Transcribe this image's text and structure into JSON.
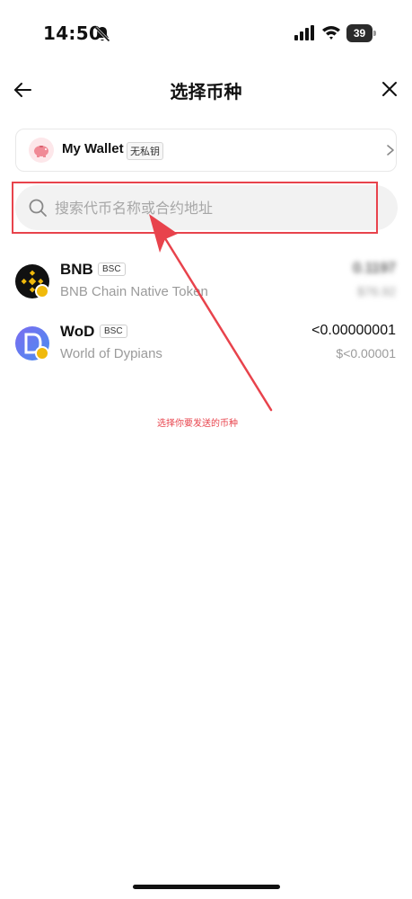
{
  "status_bar": {
    "time": "14:50",
    "battery": "39"
  },
  "header": {
    "title": "选择币种"
  },
  "wallet": {
    "name": "My Wallet",
    "tag": "无私钥"
  },
  "search": {
    "placeholder": "搜索代币名称或合约地址"
  },
  "tokens": [
    {
      "symbol": "BNB",
      "chain": "BSC",
      "name": "BNB Chain Native Token",
      "balance": "0.1197",
      "value": "$76.92"
    },
    {
      "symbol": "WoD",
      "chain": "BSC",
      "name": "World of Dypians",
      "balance": "<0.00000001",
      "value": "$<0.00001"
    }
  ],
  "annotation": {
    "text": "选择你要发送的币种",
    "color": "#e8434c"
  },
  "colors": {
    "accent_red": "#e8434c",
    "bnb_yellow": "#f0b90b",
    "wod_purple": "#6a5ae0"
  }
}
